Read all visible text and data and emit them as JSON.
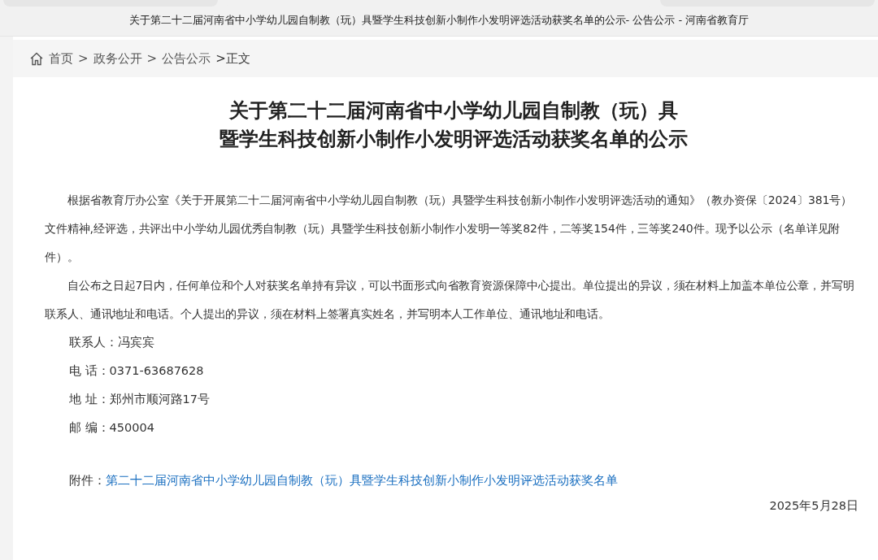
{
  "window": {
    "title": "关于第二十二届河南省中小学幼儿园自制教（玩）具暨学生科技创新小制作小发明评选活动获奖名单的公示- 公告公示 - 河南省教育厅"
  },
  "breadcrumb": [
    {
      "kind": "link",
      "text": "首页"
    },
    {
      "kind": "sep",
      "text": ">"
    },
    {
      "kind": "link",
      "text": "政务公开"
    },
    {
      "kind": "sep",
      "text": ">"
    },
    {
      "kind": "link",
      "text": "公告公示"
    },
    {
      "kind": "current",
      "text": ">正文"
    }
  ],
  "article": {
    "title_lines": [
      "关于第二十二届河南省中小学幼儿园自制教（玩）具",
      "暨学生科技创新小制作小发明评选活动获奖名单的公示"
    ],
    "paragraphs": [
      "根据省教育厅办公室《关于开展第二十二届河南省中小学幼儿园自制教（玩）具暨学生科技创新小制作小发明评选活动的通知》（教办资保〔2024〕381号）文件精神,经评选，共评出中小学幼儿园优秀自制教（玩）具暨学生科技创新小制作小发明一等奖82件，二等奖154件，三等奖240件。现予以公示（名单详见附件）。",
      "自公布之日起7日内，任何单位和个人对获奖名单持有异议，可以书面形式向省教育资源保障中心提出。单位提出的异议，须在材料上加盖本单位公章，并写明联系人、通讯地址和电话。个人提出的异议，须在材料上签署真实姓名，并写明本人工作单位、通讯地址和电话。"
    ],
    "contacts": [
      "联系人：冯宾宾",
      "电 话：0371-63687628",
      "地 址：郑州市顺河路17号",
      "邮 编：450004"
    ],
    "attachment": {
      "label": "附件：",
      "link": "第二十二届河南省中小学幼儿园自制教（玩）具暨学生科技创新小制作小发明评选活动获奖名单"
    },
    "date": "2025年5月28日"
  }
}
